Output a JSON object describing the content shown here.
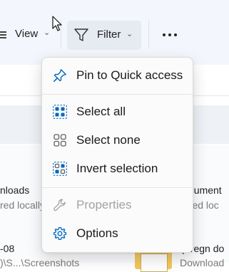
{
  "toolbar": {
    "view_label": "View",
    "filter_label": "Filter",
    "more_label": "See more",
    "chevron": "⌄"
  },
  "files": [
    {
      "name": "nloads",
      "status": "red locally"
    },
    {
      "name": "ocument",
      "status": "ored loc"
    },
    {
      "name": "-08",
      "location": ")\\S...\\Screenshots"
    },
    {
      "name": "lp regn do",
      "location": "Download"
    }
  ],
  "menu": {
    "items": [
      {
        "label": "Pin to Quick access",
        "icon": "pin-icon",
        "enabled": true
      },
      {
        "label": "Select all",
        "icon": "select-all-icon",
        "enabled": true
      },
      {
        "label": "Select none",
        "icon": "select-none-icon",
        "enabled": true
      },
      {
        "label": "Invert selection",
        "icon": "invert-selection-icon",
        "enabled": true
      },
      {
        "label": "Properties",
        "icon": "wrench-icon",
        "enabled": false
      },
      {
        "label": "Options",
        "icon": "gear-icon",
        "enabled": true
      }
    ]
  },
  "colors": {
    "accent": "#0067c0",
    "icon_gray": "#5f5f5f",
    "disabled": "#a3a3a3"
  }
}
